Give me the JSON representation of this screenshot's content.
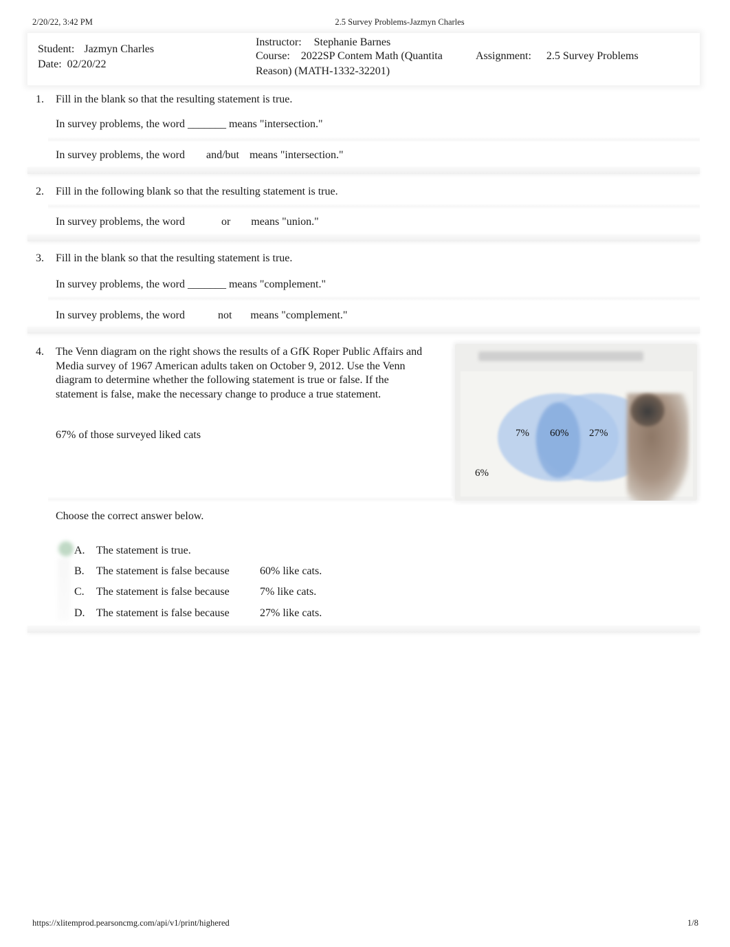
{
  "print_header": {
    "timestamp": "2/20/22, 3:42 PM",
    "title": "2.5 Survey Problems-Jazmyn Charles"
  },
  "info": {
    "student_label": "Student:",
    "student_value": "Jazmyn Charles",
    "date_label": "Date:",
    "date_value": "02/20/22",
    "instructor_label": "Instructor:",
    "instructor_value": "Stephanie Barnes",
    "course_label": "Course:",
    "course_value_line1": "2022SP Contem Math (Quantita",
    "course_value_line2": "Reason) (MATH-1332-32201)",
    "assignment_label": "Assignment:",
    "assignment_value": "2.5 Survey Problems"
  },
  "questions": [
    {
      "number": "1.",
      "prompt": "Fill in the blank so that the resulting statement is true.",
      "blank_statement": "In survey problems, the word _______ means \"intersection.\"",
      "answer_prefix": "In survey problems, the word",
      "answer_value": "and/but",
      "answer_suffix": "means \"intersection.\""
    },
    {
      "number": "2.",
      "prompt": "Fill in the following blank so that the resulting statement is true.",
      "answer_prefix": "In survey problems, the word",
      "answer_value": "or",
      "answer_suffix": "means \"union.\""
    },
    {
      "number": "3.",
      "prompt": "Fill in the blank so that the resulting statement is true.",
      "blank_statement": "In survey problems, the word _______ means \"complement.\"",
      "answer_prefix": "In survey problems, the word",
      "answer_value": "not",
      "answer_suffix": "means \"complement.\""
    },
    {
      "number": "4.",
      "prompt": "The Venn diagram on the right shows the results of a GfK Roper Public Affairs and Media survey of 1967 American adults taken on October 9, 2012. Use the Venn diagram to determine whether the following statement is true or false. If the statement is false, make the necessary change to produce a true statement.",
      "statement": "67% of those surveyed liked cats",
      "venn": {
        "left_only": "7%",
        "intersection": "60%",
        "right_only": "27%",
        "outside": "6%"
      },
      "choose_label": "Choose the correct answer below.",
      "selected_option": "A",
      "options": [
        {
          "letter": "A.",
          "text": "The statement is true.",
          "value": ""
        },
        {
          "letter": "B.",
          "text": "The statement is false because",
          "value": "60% like cats."
        },
        {
          "letter": "C.",
          "text": "The statement is false because",
          "value": "7% like cats."
        },
        {
          "letter": "D.",
          "text": "The statement is false because",
          "value": "27% like cats."
        }
      ]
    }
  ],
  "print_footer": {
    "url": "https://xlitemprod.pearsoncmg.com/api/v1/print/highered",
    "page": "1/8"
  }
}
